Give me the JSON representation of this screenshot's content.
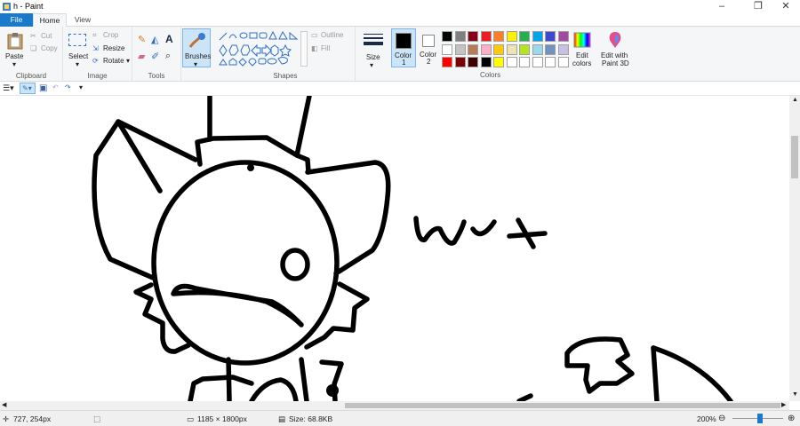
{
  "window": {
    "title": "h - Paint"
  },
  "tabs": [
    {
      "label": "File"
    },
    {
      "label": "Home"
    },
    {
      "label": "View"
    }
  ],
  "clipboard": {
    "paste": "Paste",
    "cut": "Cut",
    "copy": "Copy",
    "group": "Clipboard"
  },
  "image": {
    "select": "Select",
    "crop": "Crop",
    "resize": "Resize",
    "rotate": "Rotate",
    "group": "Image"
  },
  "tools": {
    "group": "Tools",
    "brushes": "Brushes"
  },
  "shapes": {
    "outline": "Outline",
    "fill": "Fill",
    "group": "Shapes"
  },
  "size": {
    "label": "Size"
  },
  "colors": {
    "color1": "Color\n1",
    "color1_a": "Color",
    "color1_b": "1",
    "color2_a": "Color",
    "color2_b": "2",
    "edit": "Edit\ncolors",
    "edit_a": "Edit",
    "edit_b": "colors",
    "paint3d_a": "Edit with",
    "paint3d_b": "Paint 3D",
    "group": "Colors",
    "palette": [
      "#000000",
      "#7f7f7f",
      "#880015",
      "#ed1c24",
      "#ff7f27",
      "#fff200",
      "#22b14c",
      "#00a2e8",
      "#3f48cc",
      "#a349a4",
      "#ffffff",
      "#c3c3c3",
      "#b97a57",
      "#ffaec9",
      "#ffc90e",
      "#efe4b0",
      "#b5e61d",
      "#99d9ea",
      "#7092be",
      "#c8bfe7",
      "#ff0000",
      "#7f0000",
      "#400000",
      "#000000",
      "#ffff00",
      "#ffffff",
      "#ffffff",
      "#ffffff",
      "#ffffff",
      "#ffffff"
    ],
    "primary": "#000000",
    "secondary": "#ffffff"
  },
  "status": {
    "cursor_pos": "727, 254px",
    "image_size": "1185 × 1800px",
    "file_size": "Size: 68.8KB",
    "zoom": "200%",
    "zoom_fraction": 0.55
  },
  "drawing": {
    "text_doodle": "wvt"
  }
}
